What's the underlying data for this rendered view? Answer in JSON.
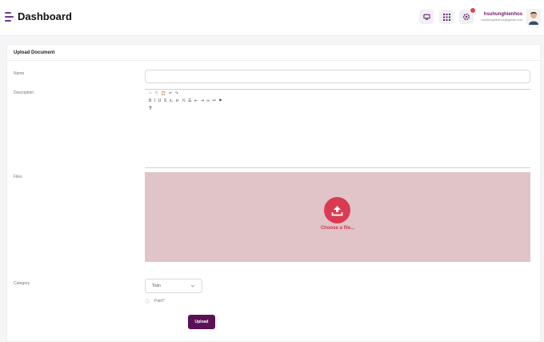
{
  "header": {
    "title": "Dashboard",
    "user_name": "hsuhunghienhos",
    "user_email": "hsuhunghienhos@gmail.com",
    "notification_badge": true
  },
  "card": {
    "title": "Upload Document"
  },
  "form": {
    "name_label": "Name",
    "description_label": "Description",
    "files_label": "Files",
    "category_label": "Category",
    "choose_file_text": "Choose a file...",
    "category_value": "Toan",
    "paid_label": "Paid?",
    "upload_label": "Upload",
    "help_glyph": "?"
  },
  "toolbar": {
    "row1": [
      {
        "name": "cut-icon",
        "glyph": "✂",
        "faint": true
      },
      {
        "name": "copy-icon",
        "glyph": "⎘",
        "faint": true
      },
      {
        "name": "paste-icon",
        "glyph": "📋"
      },
      {
        "name": "undo-icon",
        "glyph": "↶"
      },
      {
        "name": "redo-icon",
        "glyph": "↷"
      }
    ],
    "row2": [
      {
        "name": "bold-icon",
        "glyph": "B"
      },
      {
        "name": "italic-icon",
        "glyph": "I"
      },
      {
        "name": "underline-icon",
        "glyph": "U"
      },
      {
        "name": "strikethrough-icon",
        "glyph": "S"
      },
      {
        "name": "subscript-icon",
        "glyph": "x₂"
      },
      {
        "name": "superscript-icon",
        "glyph": "x²"
      },
      {
        "name": "numbered-list-icon",
        "glyph": "⅓"
      },
      {
        "name": "bulleted-list-icon",
        "glyph": "☰"
      },
      {
        "name": "outdent-icon",
        "glyph": "⇤"
      },
      {
        "name": "indent-icon",
        "glyph": "⇥"
      },
      {
        "name": "link-icon",
        "glyph": "∞"
      },
      {
        "name": "unlink-icon",
        "glyph": "⚯"
      },
      {
        "name": "anchor-flag-icon",
        "glyph": "⚑"
      }
    ]
  },
  "colors": {
    "accent": "#5b1155",
    "dropzone": "#e0c4c7",
    "upload_circle": "#db3b52",
    "badge": "#e0435b"
  }
}
